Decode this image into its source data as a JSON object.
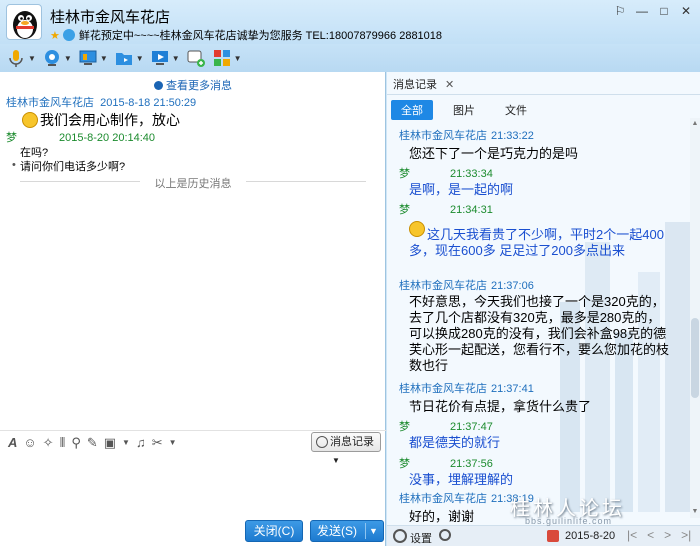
{
  "window": {
    "title": "桂林市金风车花店",
    "status_text": "鲜花预定中~~~~桂林金风车花店诚挚为您服务  TEL:18007879966  2881018",
    "controls": [
      "⚐",
      "—",
      "□",
      "✕"
    ]
  },
  "chat": {
    "more_messages": "查看更多消息",
    "history_divider": "以上是历史消息",
    "messages": [
      {
        "sender": "桂林市金风车花店",
        "time": "2015-8-18 21:50:29",
        "text": "我们会用心制作，放心"
      },
      {
        "sender": "梦",
        "time": "2015-8-20 20:14:40",
        "lines": [
          "在吗?",
          "请问你们电话多少啊?"
        ]
      }
    ],
    "history_button": "消息记录",
    "close_button": "关闭(C)",
    "send_button": "发送(S)"
  },
  "history": {
    "tab_label": "消息记录",
    "filters": [
      "全部",
      "图片",
      "文件"
    ],
    "entries": [
      {
        "sender": "桂林市金风车花店",
        "time": "21:33:22",
        "text": "您还下了一个是巧克力的是吗",
        "blue": false
      },
      {
        "sender": "梦",
        "time": "21:33:34",
        "text": "是啊，是一起的啊",
        "blue": true
      },
      {
        "sender": "梦",
        "time": "21:34:31",
        "text": "这几天我看贵了不少啊，平时2个一起400多，现在600多 足足过了200多点出来",
        "blue": true
      },
      {
        "sender": "桂林市金风车花店",
        "time": "21:37:06",
        "text": "不好意思，今天我们也接了一个是320克的，去了几个店都没有320克，最多是280克的，可以换成280克的没有，我们会补盒98克的德芙心形一起配送，您看行不，要么您加花的枝数也行",
        "blue": false
      },
      {
        "sender": "桂林市金风车花店",
        "time": "21:37:41",
        "text": "节日花价有点提，拿货什么贵了",
        "blue": false
      },
      {
        "sender": "梦",
        "time": "21:37:47",
        "text": "都是德芙的就行",
        "blue": true
      },
      {
        "sender": "梦",
        "time": "21:37:56",
        "text": "没事，埋解理解的",
        "blue": true
      },
      {
        "sender": "桂林市金风车花店",
        "time": "21:38:19",
        "text": "好的，谢谢",
        "blue": false
      }
    ],
    "settings_label": "设置",
    "date": "2015-8-20"
  },
  "watermark": {
    "main": "桂林人论坛",
    "sub": "bbs.guilinlife.com"
  },
  "colors": {
    "accent": "#1e88e5",
    "sender_blue": "#1f6fbd",
    "sender_green": "#1c8b2e",
    "message_blue": "#1a4fd0"
  }
}
